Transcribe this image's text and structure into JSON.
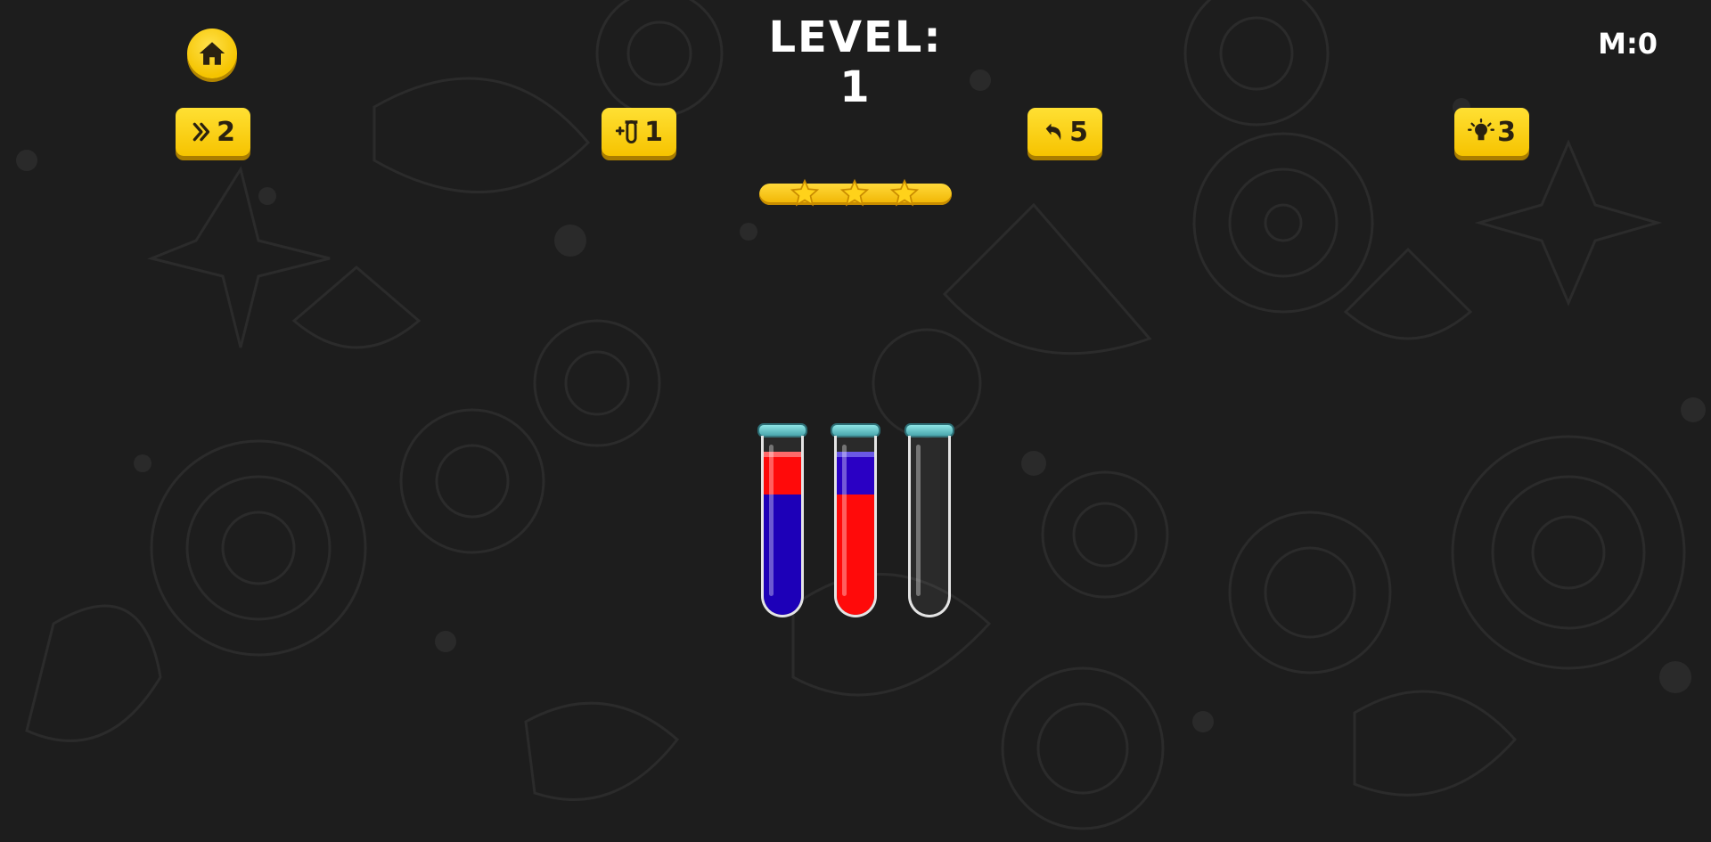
{
  "header": {
    "level_text": "LEVEL: 1",
    "moves_text": "M:0"
  },
  "buttons": {
    "home": {
      "icon": "home-icon"
    },
    "skip": {
      "icon": "double-chevron-right-icon",
      "count": "2"
    },
    "add_tube": {
      "icon": "add-tube-icon",
      "count": "1"
    },
    "undo": {
      "icon": "undo-arrow-icon",
      "count": "5"
    },
    "hint": {
      "icon": "lightbulb-icon",
      "count": "3"
    }
  },
  "rating": {
    "stars": 3,
    "max_stars": 3
  },
  "tubes": [
    {
      "layers_bottom_to_top": [
        "blue",
        "blue",
        "blue",
        "red"
      ]
    },
    {
      "layers_bottom_to_top": [
        "red",
        "red",
        "red",
        "blue"
      ]
    },
    {
      "layers_bottom_to_top": []
    }
  ],
  "colors": {
    "accent_yellow": "#f6c300",
    "red": "#ff0a0a",
    "blue": "#1d00b8",
    "background": "#1d1d1d",
    "cap": "#6cc7cc"
  }
}
